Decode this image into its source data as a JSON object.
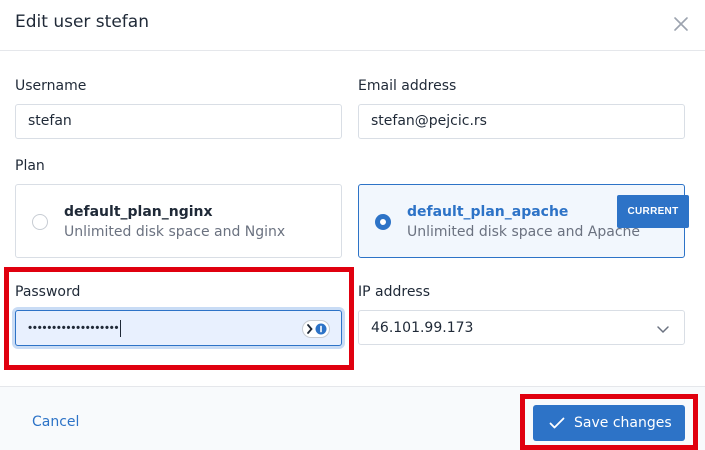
{
  "dialog": {
    "title": "Edit user stefan",
    "close_icon": "close-icon"
  },
  "form": {
    "username": {
      "label": "Username",
      "value": "stefan"
    },
    "email": {
      "label": "Email address",
      "value": "stefan@pejcic.rs"
    },
    "plan": {
      "label": "Plan",
      "options": [
        {
          "name": "default_plan_nginx",
          "description": "Unlimited disk space and Nginx",
          "selected": false
        },
        {
          "name": "default_plan_apache",
          "description": "Unlimited disk space and Apache",
          "selected": true
        }
      ],
      "current_badge": "CURRENT"
    },
    "password": {
      "label": "Password",
      "masked_value": "•••••••••••••••••••",
      "extension_icon": "password-manager-icon"
    },
    "ip_address": {
      "label": "IP address",
      "value": "46.101.99.173"
    }
  },
  "footer": {
    "cancel_label": "Cancel",
    "save_label": "Save changes",
    "save_icon": "check-icon"
  },
  "colors": {
    "accent": "#2d73c7",
    "highlight": "#e0000f"
  }
}
